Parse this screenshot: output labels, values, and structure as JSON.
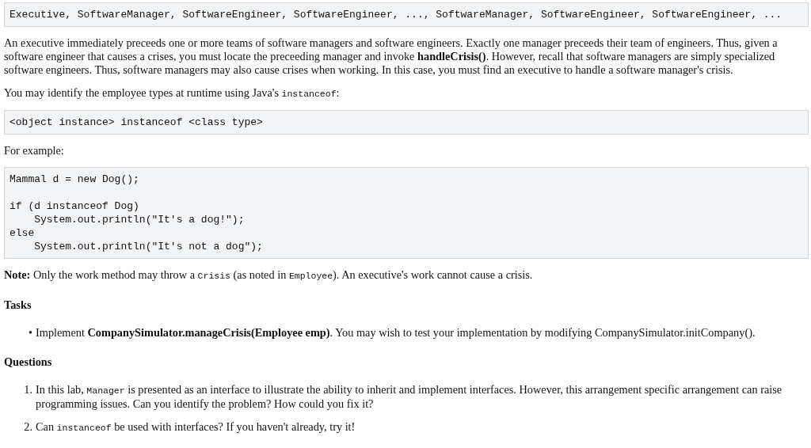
{
  "blocks": [
    {
      "kind": "code",
      "groups": [
        [
          "Executive, SoftwareManager, SoftwareEngineer, SoftwareEngineer, ..., SoftwareManager, SoftwareEngineer, SoftwareEngineer, ..."
        ]
      ]
    },
    {
      "kind": "paragraph",
      "parts": [
        {
          "kind": "text",
          "text": "An executive immediately preceeds one or more teams of software managers and software engineers. Exactly one manager preceeds their team of engineers. Thus, given a software engineer that causes a crises, you must locate the preceeding manager and invoke "
        },
        {
          "kind": "bold",
          "text": "handleCrisis()"
        },
        {
          "kind": "text",
          "text": ". However, recall that software managers are simply specialized software engineers. Thus, software managers may also cause crises when working. In this case, you must find an executive to handle a software manager's crisis."
        }
      ]
    },
    {
      "kind": "paragraph",
      "parts": [
        {
          "kind": "text",
          "text": "You may identify the employee types at runtime using Java's "
        },
        {
          "kind": "code",
          "text": "instanceof"
        },
        {
          "kind": "text",
          "text": ":"
        }
      ]
    },
    {
      "kind": "code",
      "groups": [
        [
          "<object instance> instanceof <class type>"
        ]
      ]
    },
    {
      "kind": "paragraph",
      "parts": [
        {
          "kind": "text",
          "text": "For example:"
        }
      ]
    },
    {
      "kind": "code",
      "groups": [
        [
          "Mammal d = new Dog();"
        ],
        [
          "if (d instanceof Dog)",
          "    System.out.println(\"It's a dog!\");",
          "else",
          "    System.out.println(\"It's not a dog\");"
        ]
      ]
    },
    {
      "kind": "paragraph",
      "parts": [
        {
          "kind": "bold",
          "text": "Note:"
        },
        {
          "kind": "text",
          "text": " Only the work method may throw a "
        },
        {
          "kind": "code",
          "text": "Crisis"
        },
        {
          "kind": "text",
          "text": " (as noted in "
        },
        {
          "kind": "code",
          "text": "Employee"
        },
        {
          "kind": "text",
          "text": "). An executive's work cannot cause a crisis."
        }
      ]
    },
    {
      "kind": "heading",
      "text": "Tasks"
    },
    {
      "kind": "list",
      "items": [
        {
          "marker": "•",
          "parts": [
            {
              "kind": "text",
              "text": "Implement "
            },
            {
              "kind": "bold",
              "text": "CompanySimulator.manageCrisis(Employee emp)"
            },
            {
              "kind": "text",
              "text": ". You may wish to test your implementation by modifying CompanySimulator.initCompany()."
            }
          ]
        }
      ]
    },
    {
      "kind": "heading",
      "text": "Questions"
    },
    {
      "kind": "list",
      "items": [
        {
          "marker": "1.",
          "parts": [
            {
              "kind": "text",
              "text": "In this lab, "
            },
            {
              "kind": "code",
              "text": "Manager"
            },
            {
              "kind": "text",
              "text": " is presented as an interface to illustrate the ability to inherit and implement interfaces. However, this arrangement specific arrangement can raise programming issues. Can you identify the problem? How could you fix it?"
            }
          ]
        },
        {
          "marker": "2.",
          "parts": [
            {
              "kind": "text",
              "text": "Can "
            },
            {
              "kind": "code",
              "text": "instanceof"
            },
            {
              "kind": "text",
              "text": " be used with interfaces? If you haven't already, try it!"
            }
          ]
        }
      ]
    }
  ]
}
